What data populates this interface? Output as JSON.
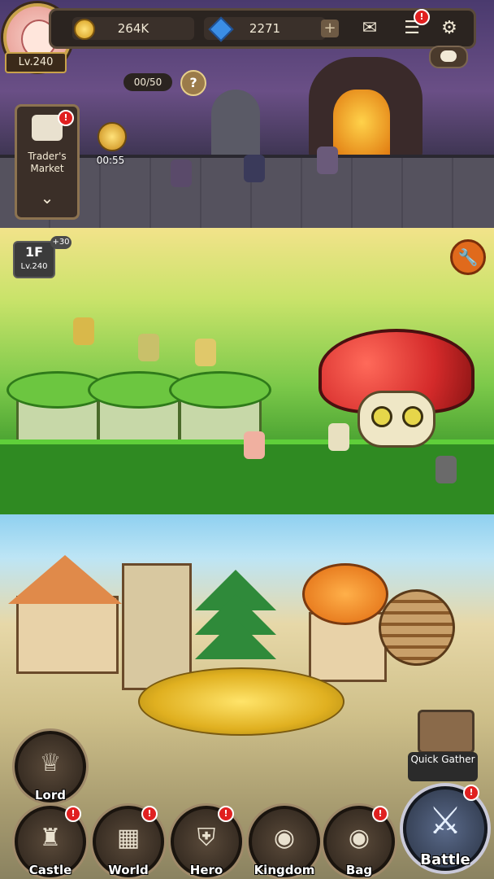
{
  "header": {
    "gold": "264K",
    "gems": "2271",
    "plus_label": "+",
    "level": "Lv.240"
  },
  "icons": {
    "mail": "mail-icon",
    "quest": "quest-scroll-icon",
    "settings": "gear-icon",
    "chat": "chat-icon"
  },
  "dungeon": {
    "progress": "00/50",
    "help": "?",
    "trader_label": "Trader's Market",
    "timer": "00:55"
  },
  "forest": {
    "floor": "1F",
    "floor_bonus": "+30",
    "floor_level": "Lv.240"
  },
  "town": {
    "quick_gather_label": "Quick Gather"
  },
  "nav": {
    "lord": "Lord",
    "castle": "Castle",
    "world": "World",
    "hero": "Hero",
    "kingdom": "Kingdom",
    "bag": "Bag",
    "battle": "Battle"
  },
  "badges": {
    "alert": "!"
  },
  "colors": {
    "dungeon_sky": "#4a3a6e",
    "forest_grass": "#7cc94a",
    "town_sky": "#8fd0f0",
    "badge_red": "#e02020",
    "wrench_orange": "#e06a1c",
    "mushroom_red": "#d42a2a"
  }
}
